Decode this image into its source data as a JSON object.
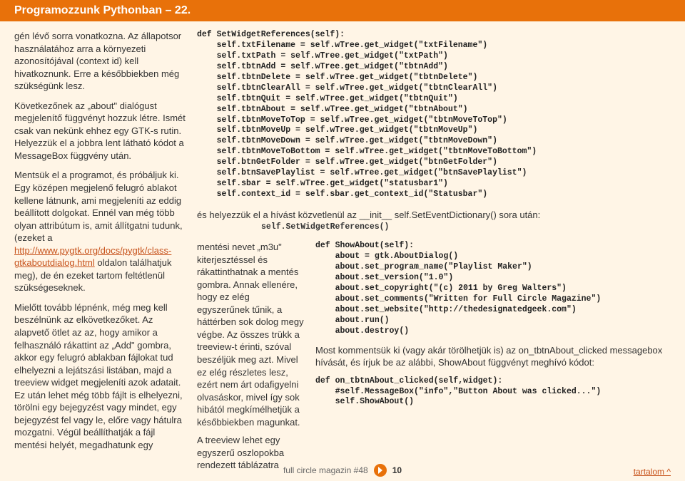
{
  "header": {
    "title": "Programozzunk Pythonban – 22."
  },
  "left": {
    "p1": "gén lévő sorra vonatkozna. Az állapotsor használatához arra a környezeti azonosítójával (context id) kell hivatkoznunk. Erre a későbbiekben még szükségünk lesz.",
    "p2": "Következőnek az „about\" dialógust megjelenítő függvényt hozzuk létre. Ismét csak van nekünk ehhez egy GTK-s rutin. Helyezzük el a jobbra lent látható kódot a MessageBox függvény után.",
    "p3a": "Mentsük el a programot, és próbáljuk ki. Egy középen megjelenő felugró ablakot kellene látnunk, ami megjeleníti az eddig beállított dolgokat. Ennél van még több olyan attribútum is, amit állítgatni tudunk, (ezeket a ",
    "link3": "http://www.pygtk.org/docs/pygtk/class-gtkaboutdialog.html",
    "p3b": " oldalon találhatjuk meg), de én ezeket tartom feltétlenül szükségeseknek.",
    "p4": "Mielőtt tovább lépnénk, még meg kell beszélnünk az elkövetkezőket. Az alapvető ötlet az az, hogy amikor a felhasználó rákattint az „Add\" gombra, akkor egy felugró ablakban fájlokat tud elhelyezni a lejátszási listában, majd a treeview widget megjeleníti azok adatait. Ez után lehet még több fájlt is elhelyezni, törölni egy bejegyzést vagy mindet, egy bejegyzést fel vagy le, előre vagy hátulra mozgatni. Végül beállíthatják a fájl mentési helyét, megadhatunk egy"
  },
  "code1": "def SetWidgetReferences(self):\n    self.txtFilename = self.wTree.get_widget(\"txtFilename\")\n    self.txtPath = self.wTree.get_widget(\"txtPath\")\n    self.tbtnAdd = self.wTree.get_widget(\"tbtnAdd\")\n    self.tbtnDelete = self.wTree.get_widget(\"tbtnDelete\")\n    self.tbtnClearAll = self.wTree.get_widget(\"tbtnClearAll\")\n    self.tbtnQuit = self.wTree.get_widget(\"tbtnQuit\")\n    self.tbtnAbout = self.wTree.get_widget(\"tbtnAbout\")\n    self.tbtnMoveToTop = self.wTree.get_widget(\"tbtnMoveToTop\")\n    self.tbtnMoveUp = self.wTree.get_widget(\"tbtnMoveUp\")\n    self.tbtnMoveDown = self.wTree.get_widget(\"tbtnMoveDown\")\n    self.tbtnMoveToBottom = self.wTree.get_widget(\"tbtnMoveToBottom\")\n    self.btnGetFolder = self.wTree.get_widget(\"btnGetFolder\")\n    self.btnSavePlaylist = self.wTree.get_widget(\"btnSavePlaylist\")\n    self.sbar = self.wTree.get_widget(\"statusbar1\")\n    self.context_id = self.sbar.get_context_id(\"Statusbar\")",
  "after1_text": "és helyezzük el a hívást közvetlenül az __init__ self.SetEventDictionary() sora után:",
  "after1_code": "self.SetWidgetReferences()",
  "mid": {
    "p1": "mentési nevet „m3u\" kiterjesztéssel és rákattinthatnak a mentés gombra. Annak ellenére, hogy ez elég egyszerűnek tűnik, a háttérben sok dolog megy végbe. Az összes trükk a treeview-t érinti, szóval beszéljük meg azt. Mivel ez elég részletes lesz, ezért nem árt odafigyelni olvasáskor, mivel így sok hibától megkímélhetjük a későbbiekben magunkat.",
    "p2": "A treeview lehet egy egyszerű oszlopokba rendezett táblázatra"
  },
  "code2": "def ShowAbout(self):\n    about = gtk.AboutDialog()\n    about.set_program_name(\"Playlist Maker\")\n    about.set_version(\"1.0\")\n    about.set_copyright(\"(c) 2011 by Greg Walters\")\n    about.set_comments(\"Written for Full Circle Magazine\")\n    about.set_website(\"http://thedesignatedgeek.com\")\n    about.run()\n    about.destroy()",
  "plain_after2": "Most kommentsük ki (vagy akár törölhetjük is) az on_tbtnAbout_clicked messagebox hívását, és írjuk be az alábbi, ShowAbout függvényt meghívó kódot:",
  "code3": "def on_tbtnAbout_clicked(self,widget):\n    #self.MessageBox(\"info\",\"Button About was clicked...\")\n    self.ShowAbout()",
  "footer": {
    "mag": "full circle magazin #48",
    "page": "10",
    "toc": "tartalom ^"
  }
}
